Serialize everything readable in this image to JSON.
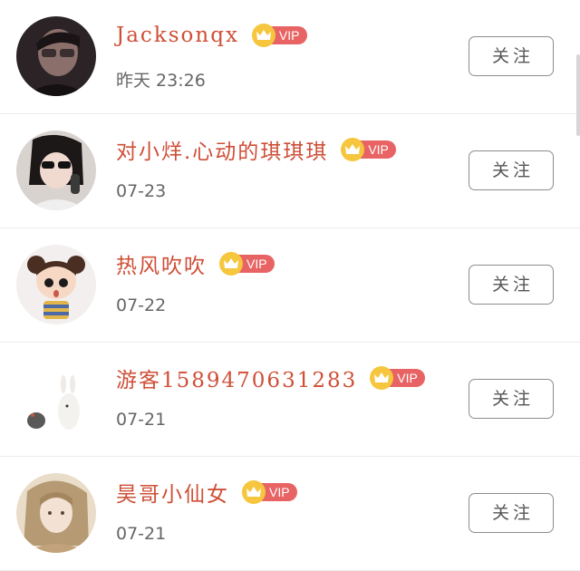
{
  "followers": [
    {
      "nickname": "Jacksonqx",
      "vip": "VIP",
      "has_vip": true,
      "date": "昨天  23:26",
      "follow_label": "关注"
    },
    {
      "nickname": "对小烊.心动的琪琪琪",
      "vip": "VIP",
      "has_vip": true,
      "date": "07-23",
      "follow_label": "关注"
    },
    {
      "nickname": "热风吹吹",
      "vip": "VIP",
      "has_vip": true,
      "date": "07-22",
      "follow_label": "关注"
    },
    {
      "nickname": "游客1589470631283",
      "vip": "VIP",
      "has_vip": true,
      "date": "07-21",
      "follow_label": "关注"
    },
    {
      "nickname": "昊哥小仙女",
      "vip": "VIP",
      "has_vip": true,
      "date": "07-21",
      "follow_label": "关注"
    }
  ],
  "colors": {
    "nickname": "#cf4f37",
    "vip_pill": "#e86464",
    "vip_crown": "#f6c63e",
    "date": "#666666",
    "button_border": "#8c8c8c"
  }
}
